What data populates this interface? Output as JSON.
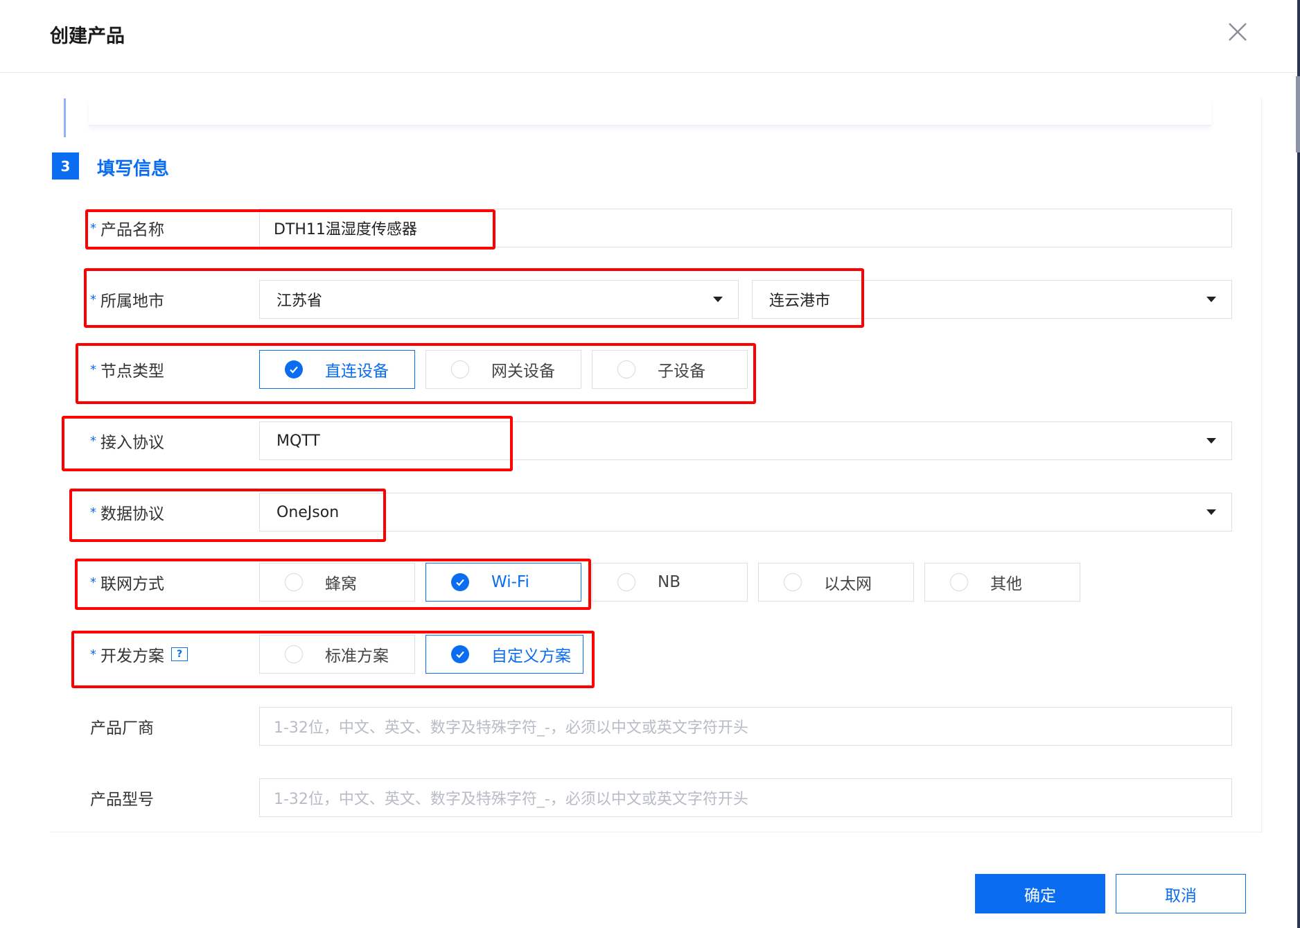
{
  "dialog": {
    "title": "创建产品",
    "confirm_label": "确定",
    "cancel_label": "取消"
  },
  "step": {
    "number": "3",
    "title": "填写信息"
  },
  "form": {
    "product_name": {
      "label": "产品名称",
      "required_mark": "*",
      "value": "DTH11温湿度传感器"
    },
    "region": {
      "label": "所属地市",
      "required_mark": "*",
      "province": "江苏省",
      "city": "连云港市"
    },
    "node_type": {
      "label": "节点类型",
      "required_mark": "*",
      "options": [
        "直连设备",
        "网关设备",
        "子设备"
      ],
      "selected": "直连设备"
    },
    "access_protocol": {
      "label": "接入协议",
      "required_mark": "*",
      "value": "MQTT"
    },
    "data_protocol": {
      "label": "数据协议",
      "required_mark": "*",
      "value": "OneJson"
    },
    "network": {
      "label": "联网方式",
      "required_mark": "*",
      "options": [
        "蜂窝",
        "Wi-Fi",
        "NB",
        "以太网",
        "其他"
      ],
      "selected": "Wi-Fi"
    },
    "dev_plan": {
      "label": "开发方案",
      "required_mark": "*",
      "help_icon": "?",
      "options": [
        "标准方案",
        "自定义方案"
      ],
      "selected": "自定义方案"
    },
    "vendor": {
      "label": "产品厂商",
      "placeholder": "1-32位，中文、英文、数字及特殊字符_-，必须以中文或英文字符开头"
    },
    "model": {
      "label": "产品型号",
      "placeholder": "1-32位，中文、英文、数字及特殊字符_-，必须以中文或英文字符开头"
    }
  },
  "colors": {
    "primary": "#0a6cf0",
    "highlight": "#ff0000",
    "border": "#dcdfe6",
    "placeholder": "#b8bcc6"
  },
  "icons": {
    "close": "close-icon",
    "check": "check-icon",
    "caret": "caret-down-icon",
    "help": "help-icon"
  }
}
